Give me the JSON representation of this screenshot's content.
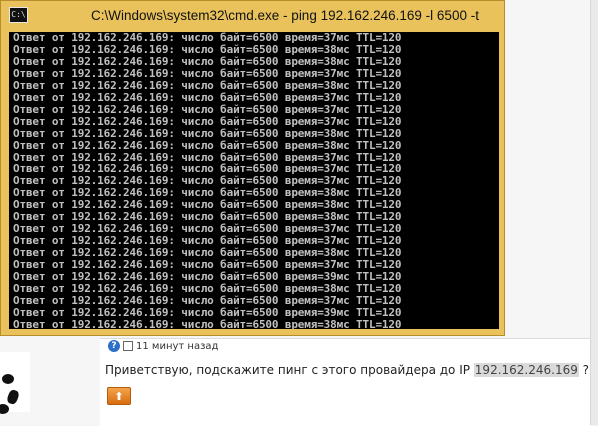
{
  "cmd": {
    "title": "C:\\Windows\\system32\\cmd.exe - ping  192.162.246.169 -l 6500 -t",
    "icon_text": "C:\\",
    "lines": [
      "Ответ от 192.162.246.169: число байт=6500 время=37мс TTL=120",
      "Ответ от 192.162.246.169: число байт=6500 время=38мс TTL=120",
      "Ответ от 192.162.246.169: число байт=6500 время=38мс TTL=120",
      "Ответ от 192.162.246.169: число байт=6500 время=37мс TTL=120",
      "Ответ от 192.162.246.169: число байт=6500 время=38мс TTL=120",
      "Ответ от 192.162.246.169: число байт=6500 время=37мс TTL=120",
      "Ответ от 192.162.246.169: число байт=6500 время=37мс TTL=120",
      "Ответ от 192.162.246.169: число байт=6500 время=37мс TTL=120",
      "Ответ от 192.162.246.169: число байт=6500 время=38мс TTL=120",
      "Ответ от 192.162.246.169: число байт=6500 время=38мс TTL=120",
      "Ответ от 192.162.246.169: число байт=6500 время=37мс TTL=120",
      "Ответ от 192.162.246.169: число байт=6500 время=37мс TTL=120",
      "Ответ от 192.162.246.169: число байт=6500 время=37мс TTL=120",
      "Ответ от 192.162.246.169: число байт=6500 время=38мс TTL=120",
      "Ответ от 192.162.246.169: число байт=6500 время=38мс TTL=120",
      "Ответ от 192.162.246.169: число байт=6500 время=38мс TTL=120",
      "Ответ от 192.162.246.169: число байт=6500 время=37мс TTL=120",
      "Ответ от 192.162.246.169: число байт=6500 время=37мс TTL=120",
      "Ответ от 192.162.246.169: число байт=6500 время=38мс TTL=120",
      "Ответ от 192.162.246.169: число байт=6500 время=37мс TTL=120",
      "Ответ от 192.162.246.169: число байт=6500 время=39мс TTL=120",
      "Ответ от 192.162.246.169: число байт=6500 время=38мс TTL=120",
      "Ответ от 192.162.246.169: число байт=6500 время=37мс TTL=120",
      "Ответ от 192.162.246.169: число байт=6500 время=39мс TTL=120",
      "Ответ от 192.162.246.169: число байт=6500 время=38мс TTL=120"
    ]
  },
  "post": {
    "help_icon": "?",
    "time_label": "11 минут назад",
    "text_before": "Приветствую, подскажите пинг с этого провайдера до IP ",
    "ip": "192.162.246.169",
    "text_after": " ?",
    "reply_icon": "reply-arrow-icon",
    "reply_glyph": "⬆"
  },
  "colors": {
    "cmd_frame": "#e9c25c",
    "console_bg": "#000000",
    "console_text": "#c0c0c0",
    "reply_button": "#e8841f"
  }
}
